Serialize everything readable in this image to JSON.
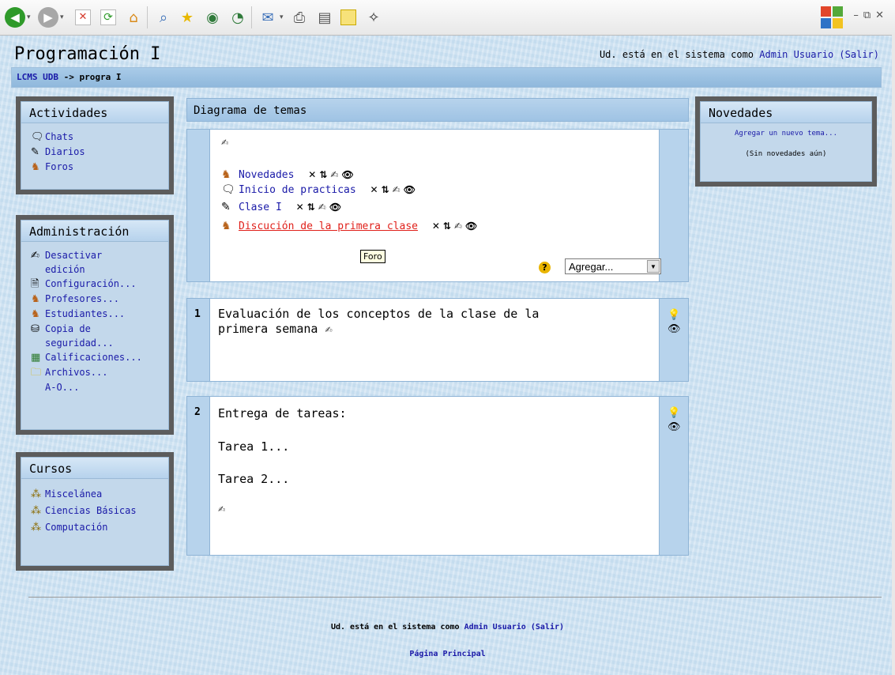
{
  "browser": {
    "colors": {
      "back": "#2f9a2a",
      "forward": "#9a9a9a",
      "stop": "#d53a2c",
      "refresh": "#2f9a2a"
    }
  },
  "header": {
    "title": "Programación I",
    "login_prefix": "Ud. está en el sistema como",
    "user_name": "Admin Usuario",
    "logout": "(Salir)"
  },
  "breadcrumb": {
    "root": "LCMS UDB",
    "separator": "->",
    "current": "progra I"
  },
  "blocks": {
    "actividades": {
      "title": "Actividades",
      "items": [
        {
          "label": "Chats",
          "icon": "chat-bubble-icon"
        },
        {
          "label": "Diarios",
          "icon": "journal-icon"
        },
        {
          "label": "Foros",
          "icon": "forum-icon"
        }
      ]
    },
    "administracion": {
      "title": "Administración",
      "items": [
        {
          "label": "Desactivar",
          "label2": "edición",
          "icon": "edit-pen-icon"
        },
        {
          "label": "Configuración...",
          "icon": "document-icon"
        },
        {
          "label": "Profesores...",
          "icon": "teachers-icon"
        },
        {
          "label": "Estudiantes...",
          "icon": "students-icon"
        },
        {
          "label": "Copia de",
          "label2": "seguridad...",
          "icon": "backup-icon"
        },
        {
          "label": "Calificaciones...",
          "icon": "grades-icon"
        },
        {
          "label": "Archivos...",
          "icon": "folder-icon"
        },
        {
          "label": "A-O...",
          "icon": ""
        }
      ]
    },
    "cursos": {
      "title": "Cursos",
      "items": [
        {
          "label": "Miscelánea",
          "icon": "category-icon"
        },
        {
          "label": "Ciencias Básicas",
          "icon": "category-icon"
        },
        {
          "label": "Computación",
          "icon": "category-icon"
        }
      ]
    },
    "novedades": {
      "title": "Novedades",
      "add_topic": "Agregar un nuevo tema...",
      "empty": "(Sin novedades aún)"
    }
  },
  "topics": {
    "title": "Diagrama de temas",
    "activities": [
      {
        "label": "Novedades",
        "icon": "forum-icon"
      },
      {
        "label": "Inicio de practicas",
        "icon": "chat-bubble-icon"
      },
      {
        "label": "Clase I",
        "icon": "journal-icon"
      },
      {
        "label": "Discución de la primera clase",
        "icon": "forum-icon",
        "highlight": true
      }
    ],
    "tooltip": "Foro",
    "add_select": "Agregar...",
    "sections": [
      {
        "num": "1",
        "lines": [
          "Evaluación de los conceptos de la clase de la",
          "primera semana"
        ]
      },
      {
        "num": "2",
        "lines": [
          "Entrega de tareas:",
          "Tarea 1...",
          "Tarea 2..."
        ]
      }
    ]
  },
  "footer": {
    "login_prefix": "Ud. está en el sistema como",
    "user_name": "Admin Usuario",
    "logout": "(Salir)",
    "home": "Página Principal"
  }
}
